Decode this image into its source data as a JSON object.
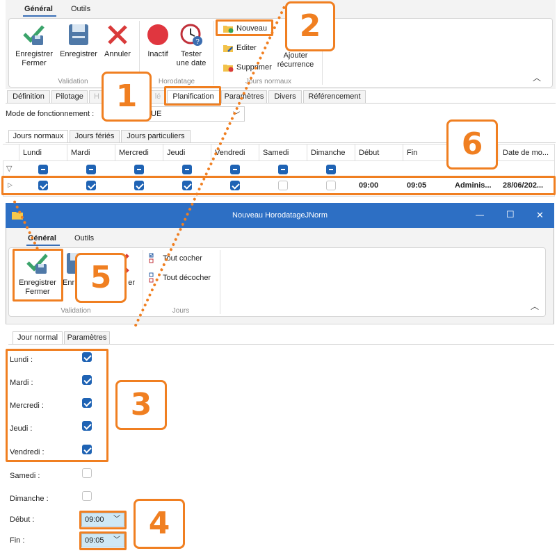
{
  "top_ribbon": {
    "tabs": [
      "Général",
      "Outils"
    ],
    "groups": {
      "validation": "Validation",
      "horodatage": "Horodatage",
      "jours_normaux": "Jours normaux"
    },
    "buttons": {
      "save_close": [
        "Enregistrer",
        "Fermer"
      ],
      "save": "Enregistrer",
      "cancel": "Annuler",
      "inactive": "Inactif",
      "test_date": [
        "Tester",
        "une date"
      ],
      "new": "Nouveau",
      "edit": "Editer",
      "delete": "Supprimer",
      "add_recurrence": [
        "Ajouter",
        "récurrence"
      ]
    }
  },
  "main_tabs": [
    "Définition",
    "Pilotage",
    "H",
    "lé",
    "Planification",
    "Paramètres",
    "Divers",
    "Référencement"
  ],
  "mode": {
    "label": "Mode de fonctionnement :",
    "value": "UE"
  },
  "sub_tabs": [
    "Jours normaux",
    "Jours fériés",
    "Jours particuliers"
  ],
  "grid": {
    "columns": [
      "Lundi",
      "Mardi",
      "Mercredi",
      "Jeudi",
      "Vendredi",
      "Samedi",
      "Dimanche",
      "Début",
      "Fin",
      "",
      "Date de mo..."
    ],
    "row": {
      "checks": [
        true,
        true,
        true,
        true,
        true,
        false,
        false
      ],
      "debut": "09:00",
      "fin": "09:05",
      "user": "Adminis...",
      "date": "28/06/202..."
    }
  },
  "dialog": {
    "title": "Nouveau HorodatageJNorm",
    "controls": {
      "minimize": "—",
      "maximize": "☐",
      "close": "✕"
    },
    "tabs": [
      "Général",
      "Outils"
    ],
    "buttons": {
      "save_close": [
        "Enregistrer",
        "Fermer"
      ],
      "save_partial": "Enr",
      "cancel_partial": "er",
      "check_all": "Tout cocher",
      "uncheck_all": "Tout décocher"
    },
    "groups": {
      "validation": "Validation",
      "jours": "Jours"
    },
    "form_tabs": [
      "Jour normal",
      "Paramètres"
    ],
    "days": [
      {
        "label": "Lundi :",
        "checked": true
      },
      {
        "label": "Mardi :",
        "checked": true
      },
      {
        "label": "Mercredi :",
        "checked": true
      },
      {
        "label": "Jeudi :",
        "checked": true
      },
      {
        "label": "Vendredi :",
        "checked": true
      },
      {
        "label": "Samedi :",
        "checked": false
      },
      {
        "label": "Dimanche :",
        "checked": false
      }
    ],
    "debut": {
      "label": "Début :",
      "value": "09:00"
    },
    "fin": {
      "label": "Fin :",
      "value": "09:05"
    }
  },
  "callouts": [
    "1",
    "2",
    "3",
    "4",
    "5",
    "6"
  ],
  "colors": {
    "accent": "#f07f21",
    "titlebar": "#2d6fc4",
    "checkbox": "#1f63b4"
  }
}
